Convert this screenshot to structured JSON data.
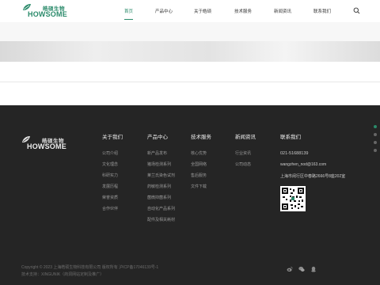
{
  "brand": {
    "name_cn": "皓硕生物",
    "name_en": "HOWSOME",
    "accent": "#2a8a6a"
  },
  "nav": {
    "items": [
      {
        "label": "首页"
      },
      {
        "label": "产品中心"
      },
      {
        "label": "关于皓硕"
      },
      {
        "label": "技术服务"
      },
      {
        "label": "新闻资讯"
      },
      {
        "label": "联系我们"
      }
    ],
    "active_index": 0,
    "search_icon": "search-icon"
  },
  "footer": {
    "columns": [
      {
        "title": "关于我们",
        "items": [
          "公司介绍",
          "文化理念",
          "科研实力",
          "发展历程",
          "荣誉资质",
          "合作伙伴"
        ]
      },
      {
        "title": "产品中心",
        "items": [
          "新产品发布",
          "猪场检测系列",
          "莱兰氏染色试剂",
          "药敏检测系列",
          "菌微抑菌系列",
          "自动化产品系列",
          "配件及相关耗材"
        ]
      },
      {
        "title": "技术服务",
        "items": [
          "核心优势",
          "全国网络",
          "售后服务",
          "文件下载"
        ]
      },
      {
        "title": "新闻资讯",
        "items": [
          "行业资讯",
          "公司动态"
        ]
      }
    ],
    "contact": {
      "title": "联系我们",
      "phone": "021-51688139",
      "email": "wangzhen_nod@163.com",
      "address": "上海市闵行区中春路2666号8座202室"
    },
    "copyright_line1": "Copyright © 2023 上海皓硕生物科技有限公司 版权所有  沪ICP备17046139号-1",
    "copyright_line2": "技术支持：XINGUNIK（商洞网站定制及推广）",
    "social_icons": [
      "weibo-icon",
      "wechat-icon",
      "qq-icon"
    ]
  },
  "slider_dots": {
    "count": 4,
    "active_index": 0
  }
}
